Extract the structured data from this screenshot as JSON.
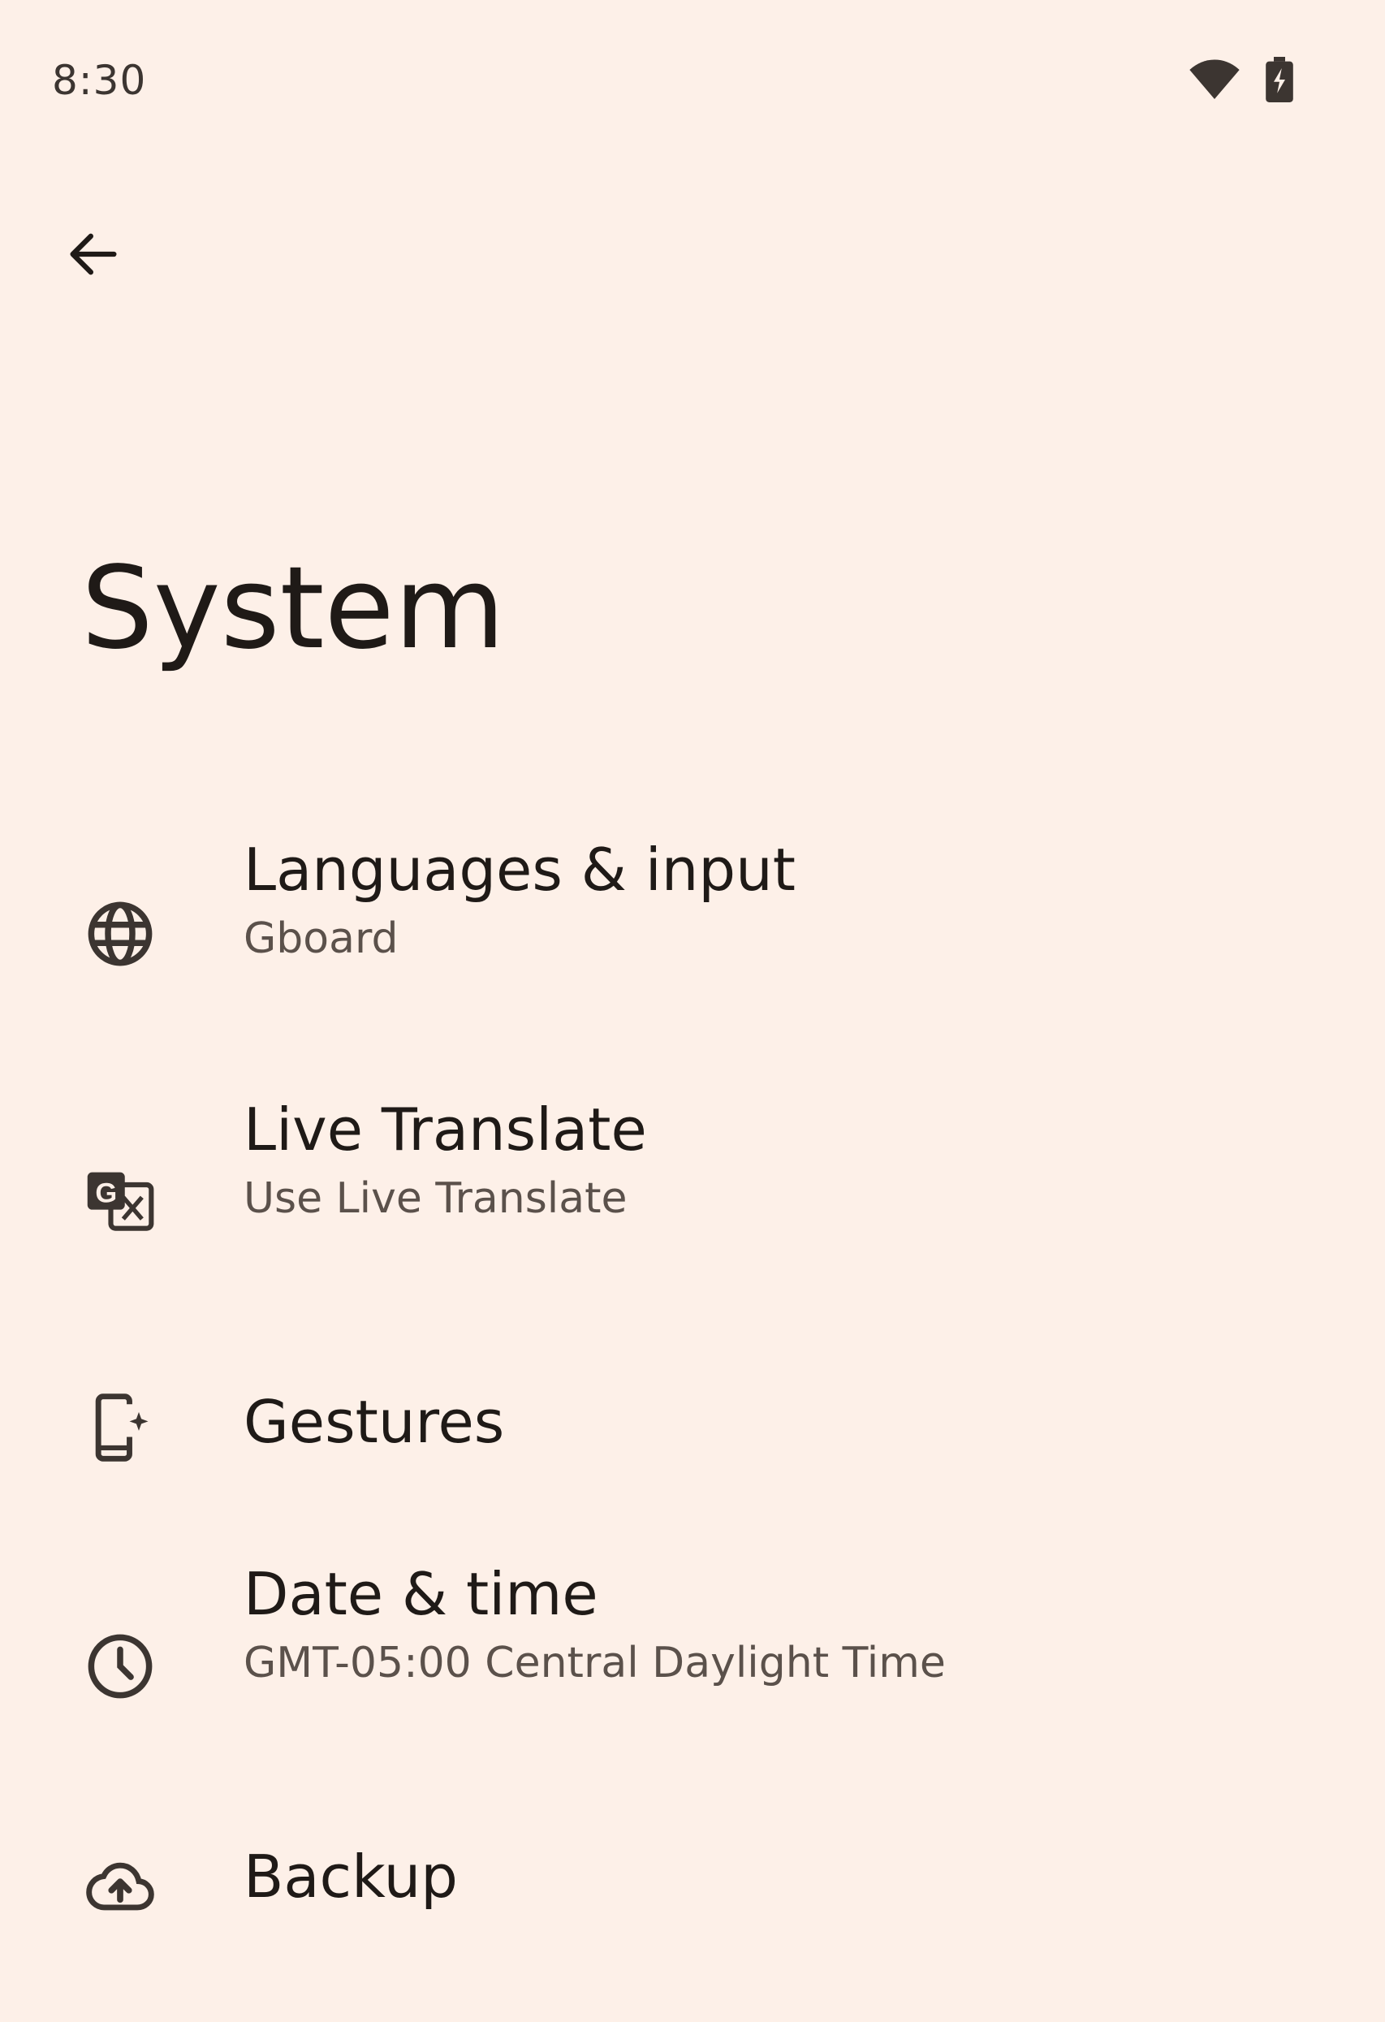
{
  "status_bar": {
    "time": "8:30",
    "icons": [
      "wifi-icon",
      "battery-charging-icon"
    ]
  },
  "header": {
    "back_icon": "arrow-back-icon",
    "title": "System"
  },
  "settings": {
    "items": [
      {
        "icon": "globe-icon",
        "title": "Languages & input",
        "summary": "Gboard"
      },
      {
        "icon": "translate-icon",
        "title": "Live Translate",
        "summary": "Use Live Translate"
      },
      {
        "icon": "gestures-phone-icon",
        "title": "Gestures",
        "summary": ""
      },
      {
        "icon": "clock-icon",
        "title": "Date & time",
        "summary": "GMT-05:00 Central Daylight Time"
      },
      {
        "icon": "cloud-upload-icon",
        "title": "Backup",
        "summary": ""
      }
    ]
  },
  "colors": {
    "background": "#fdf0e8",
    "text_primary": "#1f1a17",
    "text_secondary": "#5b514b",
    "icon": "#3c3531"
  }
}
